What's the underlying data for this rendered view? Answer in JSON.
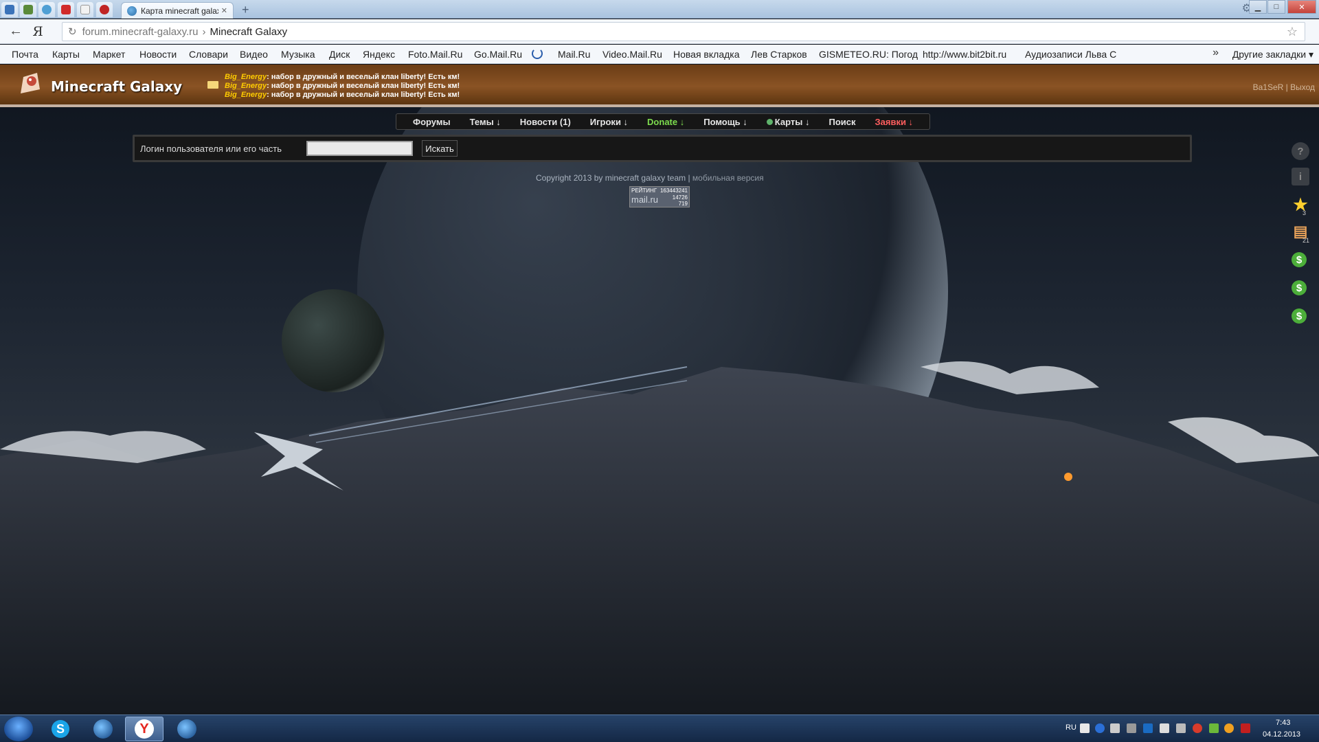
{
  "browser": {
    "active_tab_title": "Карта minecraft galaxy",
    "new_tab_symbol": "+",
    "address": {
      "domain": "forum.minecraft-galaxy.ru",
      "separator": "›",
      "page_title": "Minecraft Galaxy"
    },
    "bookmarks": [
      "Почта",
      "Карты",
      "Маркет",
      "Новости",
      "Словари",
      "Видео",
      "Музыка",
      "Диск",
      "Яндекс",
      "Foto.Mail.Ru",
      "Go.Mail.Ru",
      "Mail.Ru",
      "Video.Mail.Ru",
      "Новая вкладка",
      "Лев Старков",
      "GISMETEO.RU: Погод",
      "http://www.bit2bit.ru",
      "Аудиозаписи Льва С"
    ],
    "bookmarks_overflow": "»",
    "other_bookmarks": "Другие закладки ▾"
  },
  "site": {
    "title": "Minecraft Galaxy",
    "shoutbox": [
      {
        "user": "Big_Energy",
        "text": ": набор в дружный и веселый клан liberty! Есть км!"
      },
      {
        "user": "Big_Energy",
        "text": ": набор в дружный и веселый клан liberty! Есть км!"
      },
      {
        "user": "Big_Energy",
        "text": ": набор в дружный и веселый клан liberty! Есть км!"
      }
    ],
    "user": {
      "name": "Ba1SeR",
      "separator": " | ",
      "logout": "Выход"
    },
    "nav": {
      "forums": "Форумы",
      "topics": "Темы ↓",
      "news": "Новости (1)",
      "players": "Игроки ↓",
      "donate": "Donate ↓",
      "help": "Помощь ↓",
      "maps": "Карты ↓",
      "search": "Поиск",
      "requests": "Заявки ↓"
    },
    "search": {
      "label": "Логин пользователя или его часть",
      "input_value": "",
      "button": "Искать"
    },
    "footer": {
      "copyright": "Copyright 2013 by minecraft galaxy team",
      "separator": " | ",
      "mobile": "мобильная версия"
    },
    "counter": {
      "label": "РЕЙТИНГ",
      "line1": "163443241",
      "line2": "14726",
      "line3": "719",
      "brand": "mail.ru"
    },
    "side_icons": [
      {
        "icon": "question-icon",
        "glyph": "?",
        "count": ""
      },
      {
        "icon": "info-icon",
        "glyph": "i",
        "count": ""
      },
      {
        "icon": "star-icon",
        "glyph": "★",
        "count": "3"
      },
      {
        "icon": "message-icon",
        "glyph": "▤",
        "count": "21"
      },
      {
        "icon": "dollar-icon",
        "glyph": "$",
        "count": ""
      },
      {
        "icon": "dollar-icon",
        "glyph": "$",
        "count": ""
      },
      {
        "icon": "dollar-icon",
        "glyph": "$",
        "count": ""
      }
    ]
  },
  "taskbar": {
    "language": "RU",
    "time": "7:43",
    "date": "04.12.2013"
  },
  "colors": {
    "header_brown": "#8a5324",
    "shout_user": "#ffcc00",
    "donate_green": "#7ddc4e",
    "requests_red": "#ff5e5e"
  }
}
